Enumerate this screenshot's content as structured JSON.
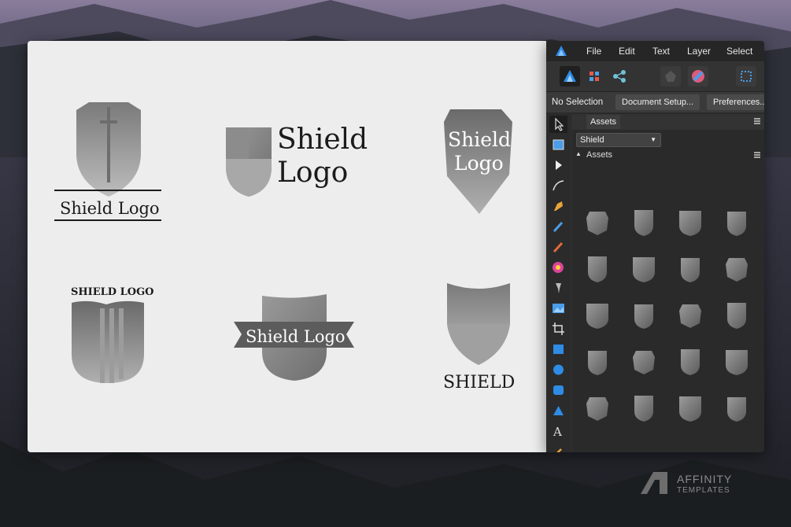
{
  "canvas": {
    "logos": [
      {
        "name": "shield-sword-logo",
        "text": "Shield Logo"
      },
      {
        "name": "shield-split-logo",
        "text_line1": "Shield",
        "text_line2": "Logo"
      },
      {
        "name": "shield-badge-logo",
        "text_line1": "Shield",
        "text_line2": "Logo"
      },
      {
        "name": "shield-stripes-logo",
        "text": "SHIELD LOGO"
      },
      {
        "name": "shield-ribbon-logo",
        "text": "Shield Logo"
      },
      {
        "name": "shield-pointed-logo",
        "text": "SHIELD"
      }
    ]
  },
  "menu": {
    "items": [
      "File",
      "Edit",
      "Text",
      "Layer",
      "Select"
    ]
  },
  "toolbar": {
    "icons": [
      "affinity-designer-icon",
      "pixel-persona-icon",
      "export-persona-icon",
      "snapping-icon",
      "color-wheel-icon",
      "grid-icon"
    ]
  },
  "context": {
    "selection_label": "No Selection",
    "document_setup": "Document Setup...",
    "preferences": "Preferences..."
  },
  "assets": {
    "tab_label": "Assets",
    "category_dropdown": "Shield",
    "category_header": "Assets",
    "item_count": 20
  },
  "watermark": {
    "line1": "AFFINITY",
    "line2": "TEMPLATES"
  },
  "colors": {
    "panel_bg": "#2f2f2f",
    "canvas_bg": "#ededed",
    "shield_gray": "#8a8a8a",
    "accent_blue": "#2e8be6"
  }
}
